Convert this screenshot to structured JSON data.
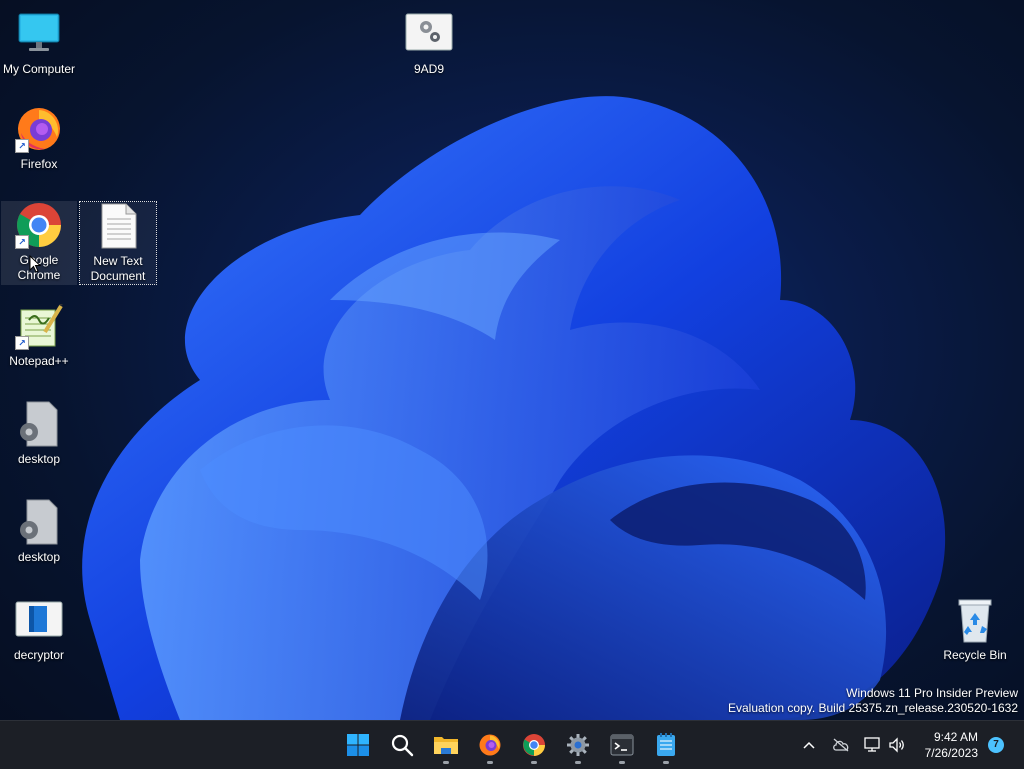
{
  "desktop": {
    "icons": [
      {
        "label": "My Computer",
        "icon": "monitor-icon"
      },
      {
        "label": "9AD9",
        "icon": "settings-file-icon"
      },
      {
        "label": "Firefox",
        "icon": "firefox-icon",
        "shortcut": true
      },
      {
        "label": "Google Chrome",
        "icon": "chrome-icon",
        "shortcut": true,
        "state": "hovered"
      },
      {
        "label": "New Text Document",
        "icon": "text-file-icon",
        "state": "selected"
      },
      {
        "label": "Notepad++",
        "icon": "notepad-plus-plus-icon",
        "shortcut": true
      },
      {
        "label": "desktop",
        "icon": "settings-file-icon"
      },
      {
        "label": "desktop",
        "icon": "settings-file-icon"
      },
      {
        "label": "decryptor",
        "icon": "app-window-icon"
      },
      {
        "label": "Recycle Bin",
        "icon": "recycle-bin-icon"
      }
    ],
    "watermark": {
      "line1": "Windows 11 Pro Insider Preview",
      "line2": "Evaluation copy. Build 25375.zn_release.230520-1632"
    }
  },
  "taskbar": {
    "apps": [
      {
        "name": "Start",
        "icon": "windows-start-icon",
        "running": false
      },
      {
        "name": "Search",
        "icon": "search-icon",
        "running": false
      },
      {
        "name": "File Explorer",
        "icon": "folder-icon",
        "running": true
      },
      {
        "name": "Firefox",
        "icon": "firefox-icon",
        "running": true
      },
      {
        "name": "Google Chrome",
        "icon": "chrome-icon",
        "running": true
      },
      {
        "name": "Settings",
        "icon": "gear-icon",
        "running": true
      },
      {
        "name": "Terminal",
        "icon": "terminal-icon",
        "running": true
      },
      {
        "name": "Notepad",
        "icon": "notepad-icon",
        "running": true
      }
    ],
    "tray": {
      "icons": [
        "chevron-up-icon",
        "cloud-offline-icon",
        "network-icon",
        "speaker-icon"
      ],
      "time": "9:42 AM",
      "date": "7/26/2023",
      "notification_count": "7"
    }
  },
  "colors": {
    "accent": "#4cc2ff",
    "taskbar_bg": "#1c1f26",
    "wallpaper_dark": "#050d1f",
    "bloom_blue": "#1f5bff"
  }
}
